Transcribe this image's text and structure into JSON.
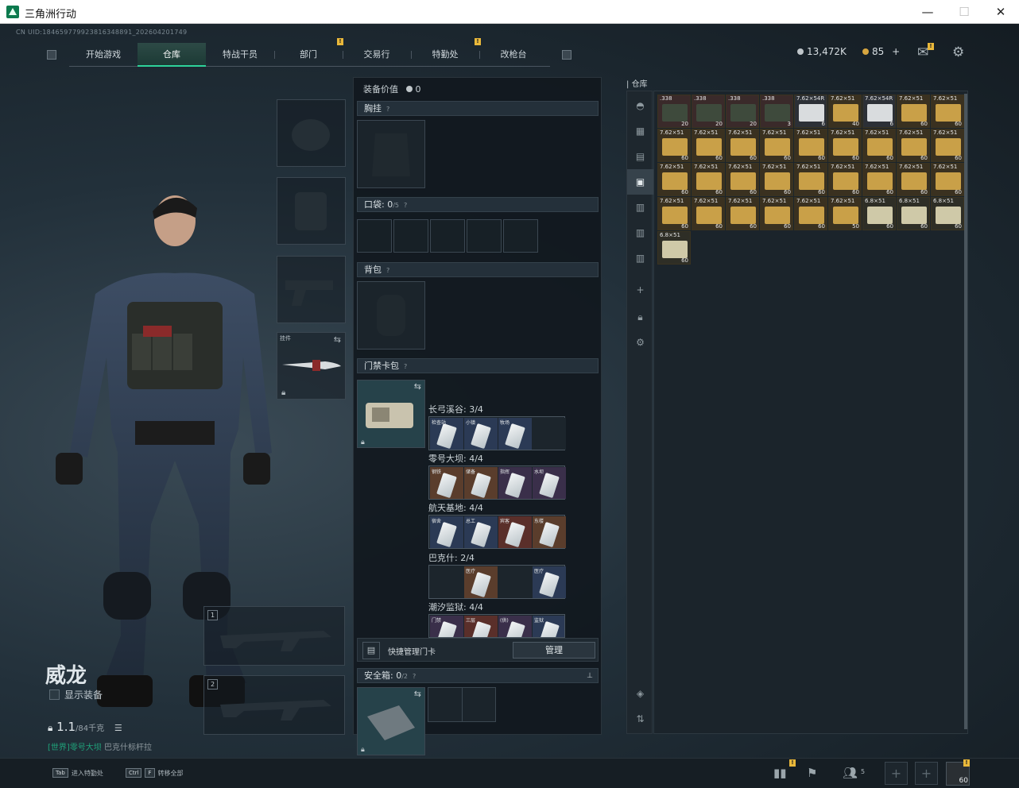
{
  "window": {
    "title": "三角洲行动",
    "minimize": "—",
    "maximize": "☐",
    "close": "✕"
  },
  "header": {
    "uid": "CN UID:184659779923816348891_202604201749",
    "tabs": [
      {
        "label": "开始游戏"
      },
      {
        "label": "仓库",
        "active": true
      },
      {
        "label": "特战干员"
      },
      {
        "label": "部门"
      },
      {
        "label": "交易行"
      },
      {
        "label": "特勤处"
      },
      {
        "label": "改枪台"
      }
    ],
    "currency_silver": "13,472K",
    "currency_gold": "85",
    "gold_plus": "+",
    "badge_mark": "!"
  },
  "operator": {
    "name": "威龙",
    "show_equipment": "显示装备",
    "weight_value": "1.1",
    "weight_capacity": "/84千克",
    "location_tag": "[世界]",
    "location_highlight": "零号大坝",
    "location_rest": "巴克什标杆拉"
  },
  "gear": {
    "melee_label": "挂件",
    "weapon_slot_1": "1",
    "weapon_slot_2": "2"
  },
  "loadout": {
    "equip_value_label": "装备价值",
    "equip_value": "0",
    "chest_label": "胸挂",
    "pocket_label": "口袋:",
    "pocket_count": "0",
    "pocket_cap": "/5",
    "backpack_label": "背包",
    "keycard_label": "门禁卡包",
    "q": "?",
    "maps": [
      {
        "name": "长弓溪谷: 3/4",
        "cards": [
          "检查站",
          "小镇",
          "牧场",
          ""
        ]
      },
      {
        "name": "零号大坝: 4/4",
        "cards": [
          "钢铁",
          "储备",
          "指挥",
          "水坝"
        ]
      },
      {
        "name": "航天基地: 4/4",
        "cards": [
          "宿舍",
          "总工",
          "宾客",
          "东楼"
        ]
      },
      {
        "name": "巴克什: 2/4",
        "cards": [
          "",
          "医疗",
          "",
          "医疗"
        ]
      },
      {
        "name": "潮汐监狱: 4/4",
        "cards": [
          "门禁",
          "三层",
          "(供)",
          "监狱"
        ]
      }
    ],
    "quick_manage_label": "快捷管理门卡",
    "manage_button": "管理",
    "safebox_label": "安全箱:",
    "safebox_count": "0",
    "safebox_cap": "/2",
    "pin": "📌"
  },
  "warehouse": {
    "label": "仓库",
    "items": [
      {
        "cap": ".338",
        "cnt": "20",
        "kind": "green"
      },
      {
        "cap": ".338",
        "cnt": "20",
        "kind": "green"
      },
      {
        "cap": ".338",
        "cnt": "20",
        "kind": "green"
      },
      {
        "cap": ".338",
        "cnt": "3",
        "kind": "green"
      },
      {
        "cap": "7.62×54R",
        "cnt": "6",
        "kind": "white"
      },
      {
        "cap": "7.62×51",
        "cnt": "40",
        "kind": "gold"
      },
      {
        "cap": "7.62×54R",
        "cnt": "6",
        "kind": "white"
      },
      {
        "cap": "7.62×51",
        "cnt": "60",
        "kind": "gold"
      },
      {
        "cap": "7.62×51",
        "cnt": "60",
        "kind": "gold"
      },
      {
        "cap": "7.62×51",
        "cnt": "60",
        "kind": "gold"
      },
      {
        "cap": "7.62×51",
        "cnt": "60",
        "kind": "gold"
      },
      {
        "cap": "7.62×51",
        "cnt": "60",
        "kind": "gold"
      },
      {
        "cap": "7.62×51",
        "cnt": "60",
        "kind": "gold"
      },
      {
        "cap": "7.62×51",
        "cnt": "60",
        "kind": "gold"
      },
      {
        "cap": "7.62×51",
        "cnt": "60",
        "kind": "gold"
      },
      {
        "cap": "7.62×51",
        "cnt": "60",
        "kind": "gold"
      },
      {
        "cap": "7.62×51",
        "cnt": "60",
        "kind": "gold"
      },
      {
        "cap": "7.62×51",
        "cnt": "60",
        "kind": "gold"
      },
      {
        "cap": "7.62×51",
        "cnt": "60",
        "kind": "gold"
      },
      {
        "cap": "7.62×51",
        "cnt": "60",
        "kind": "gold"
      },
      {
        "cap": "7.62×51",
        "cnt": "60",
        "kind": "gold"
      },
      {
        "cap": "7.62×51",
        "cnt": "60",
        "kind": "gold"
      },
      {
        "cap": "7.62×51",
        "cnt": "60",
        "kind": "gold"
      },
      {
        "cap": "7.62×51",
        "cnt": "60",
        "kind": "gold"
      },
      {
        "cap": "7.62×51",
        "cnt": "60",
        "kind": "gold"
      },
      {
        "cap": "7.62×51",
        "cnt": "60",
        "kind": "gold"
      },
      {
        "cap": "7.62×51",
        "cnt": "60",
        "kind": "gold"
      },
      {
        "cap": "7.62×51",
        "cnt": "60",
        "kind": "gold"
      },
      {
        "cap": "7.62×51",
        "cnt": "60",
        "kind": "gold"
      },
      {
        "cap": "7.62×51",
        "cnt": "60",
        "kind": "gold"
      },
      {
        "cap": "7.62×51",
        "cnt": "60",
        "kind": "gold"
      },
      {
        "cap": "7.62×51",
        "cnt": "60",
        "kind": "gold"
      },
      {
        "cap": "7.62×51",
        "cnt": "50",
        "kind": "gold"
      },
      {
        "cap": "6.8×51",
        "cnt": "60",
        "kind": "pale"
      },
      {
        "cap": "6.8×51",
        "cnt": "60",
        "kind": "pale"
      },
      {
        "cap": "6.8×51",
        "cnt": "60",
        "kind": "pale"
      },
      {
        "cap": "6.8×51",
        "cnt": "60",
        "kind": "pale"
      }
    ]
  },
  "bottom": {
    "tab_key": "Tab",
    "tab_hint": "进入特勤处",
    "ctrl_key": "Ctrl",
    "f_key": "F",
    "ctrl_hint": "转移全部",
    "squad_count": "5",
    "slot_count": "60"
  },
  "colors": {
    "accent": "#2ed39a",
    "badge": "#e9b83a",
    "gold_box": "#c9a048",
    "green_box": "#3d4a3a"
  }
}
